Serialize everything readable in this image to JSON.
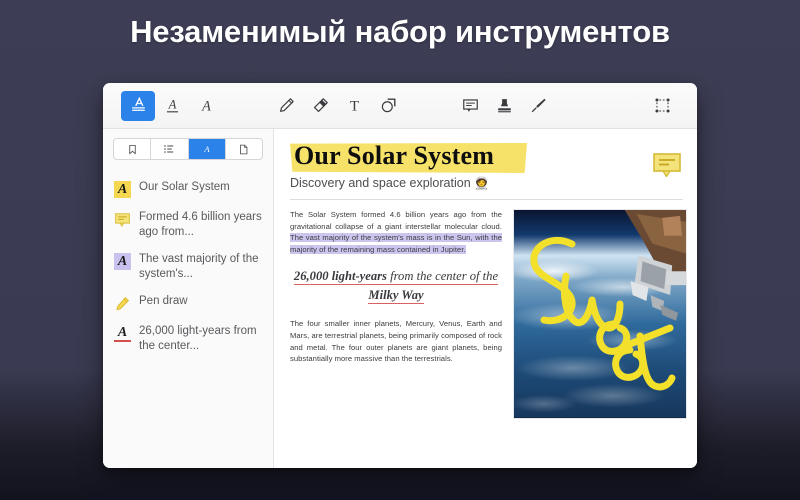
{
  "hero": {
    "headline": "Незаменимый набор инструментов"
  },
  "colors": {
    "page_background": "#3a3a52",
    "accent_blue": "#2b82e8",
    "highlight_yellow": "#f5e05c",
    "highlight_purple": "#ccc5ee",
    "underline_red": "#d8625f",
    "pen_yellow": "#f2e02a"
  },
  "toolbar": {
    "groups": [
      {
        "name": "text-markup",
        "items": [
          {
            "icon": "highlight-text-icon",
            "label": "Highlight",
            "active": true
          },
          {
            "icon": "underline-text-icon",
            "label": "Underline",
            "active": false
          },
          {
            "icon": "strikethrough-text-icon",
            "label": "Strikethrough",
            "active": false
          }
        ]
      },
      {
        "name": "drawing",
        "items": [
          {
            "icon": "pencil-icon",
            "label": "Pencil",
            "active": false
          },
          {
            "icon": "eraser-icon",
            "label": "Eraser",
            "active": false
          },
          {
            "icon": "text-tool-icon",
            "label": "Text",
            "active": false
          },
          {
            "icon": "shapes-icon",
            "label": "Shapes",
            "active": false
          }
        ]
      },
      {
        "name": "annotations",
        "items": [
          {
            "icon": "comment-bubble-icon",
            "label": "Note",
            "active": false
          },
          {
            "icon": "stamp-icon",
            "label": "Stamp",
            "active": false
          },
          {
            "icon": "signature-pen-icon",
            "label": "Signature",
            "active": false
          }
        ]
      },
      {
        "name": "selection",
        "items": [
          {
            "icon": "marquee-select-icon",
            "label": "Select area",
            "active": false
          }
        ]
      }
    ]
  },
  "sidebar": {
    "tabs": [
      {
        "icon": "bookmark-icon",
        "label": "Bookmarks",
        "active": false
      },
      {
        "icon": "outline-list-icon",
        "label": "Outline",
        "active": false
      },
      {
        "icon": "annotations-a-icon",
        "label": "Annotations",
        "active": true
      },
      {
        "icon": "page-thumbnail-icon",
        "label": "Pages",
        "active": false
      }
    ],
    "items": [
      {
        "marker": "highlight-yellow",
        "glyph": "A",
        "label": "Our Solar System"
      },
      {
        "marker": "note",
        "glyph": "",
        "label": "Formed 4.6 billion years ago from..."
      },
      {
        "marker": "highlight-purple",
        "glyph": "A",
        "label": "The vast majority of the system's..."
      },
      {
        "marker": "pen",
        "glyph": "",
        "label": "Pen draw"
      },
      {
        "marker": "underline-red",
        "glyph": "A",
        "label": "26,000 light-years from the center..."
      }
    ]
  },
  "document": {
    "title": "Our Solar System",
    "subtitle": "Discovery and space exploration",
    "subtitle_emoji": "🧑‍🚀",
    "note_icon": "comment-bubble-icon",
    "paragraph_1_plain": "The Solar System formed 4.6 billion years ago from the gravitational collapse of a giant interstellar molecular cloud. ",
    "paragraph_1_highlighted": "The vast majority of the system's mass is in the Sun, with the majority of the remaining mass contained in Jupiter.",
    "quote_part_1": "26,000 light-years",
    "quote_part_2": " from the center of the ",
    "quote_part_3": "Milky Way",
    "paragraph_2": "The four smaller inner planets, Mercury, Venus, Earth and Mars, are terrestrial planets, being primarily composed of rock and metal. The four outer planets are giant planets, being substantially more massive than the terrestrials.",
    "photo": {
      "name": "earth-from-orbit-photo",
      "ink_annotation": "sweet"
    }
  }
}
